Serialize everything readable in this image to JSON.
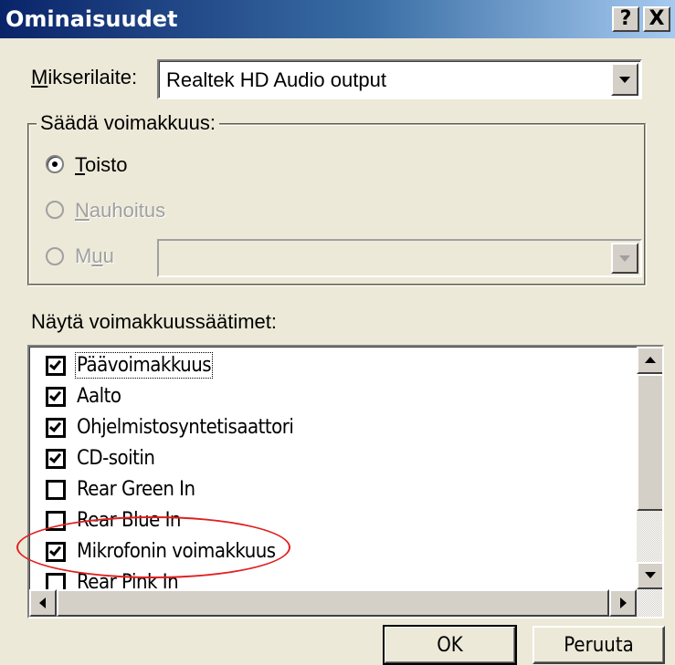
{
  "window": {
    "title": "Ominaisuudet",
    "help_button": "?",
    "close_button": "X"
  },
  "mixer": {
    "label_accel": "M",
    "label_rest": "ikserilaite:",
    "selected": "Realtek HD Audio output"
  },
  "volume_group": {
    "title": "Säädä voimakkuus:",
    "options": [
      {
        "accel": "T",
        "rest": "oisto",
        "selected": true,
        "enabled": true
      },
      {
        "accel": "N",
        "rest": "auhoitus",
        "selected": false,
        "enabled": false
      },
      {
        "pre": "M",
        "accel": "u",
        "rest": "u",
        "selected": false,
        "enabled": false
      }
    ],
    "other_value": ""
  },
  "controls_label": "Näytä voimakkuussäätimet:",
  "controls": [
    {
      "label": "Päävoimakkuus",
      "checked": true
    },
    {
      "label": "Aalto",
      "checked": true
    },
    {
      "label": "Ohjelmistosyntetisaattori",
      "checked": true
    },
    {
      "label": "CD-soitin",
      "checked": true
    },
    {
      "label": "Rear Green In",
      "checked": false
    },
    {
      "label": "Rear Blue In",
      "checked": false
    },
    {
      "label": "Mikrofonin voimakkuus",
      "checked": true
    },
    {
      "label": "Rear Pink In",
      "checked": false
    }
  ],
  "vertical_scroll_position": 0.0,
  "buttons": {
    "ok": "OK",
    "cancel": "Peruuta"
  },
  "colors": {
    "annotation": "#E02020",
    "dialog_bg": "#ECE9D8"
  }
}
